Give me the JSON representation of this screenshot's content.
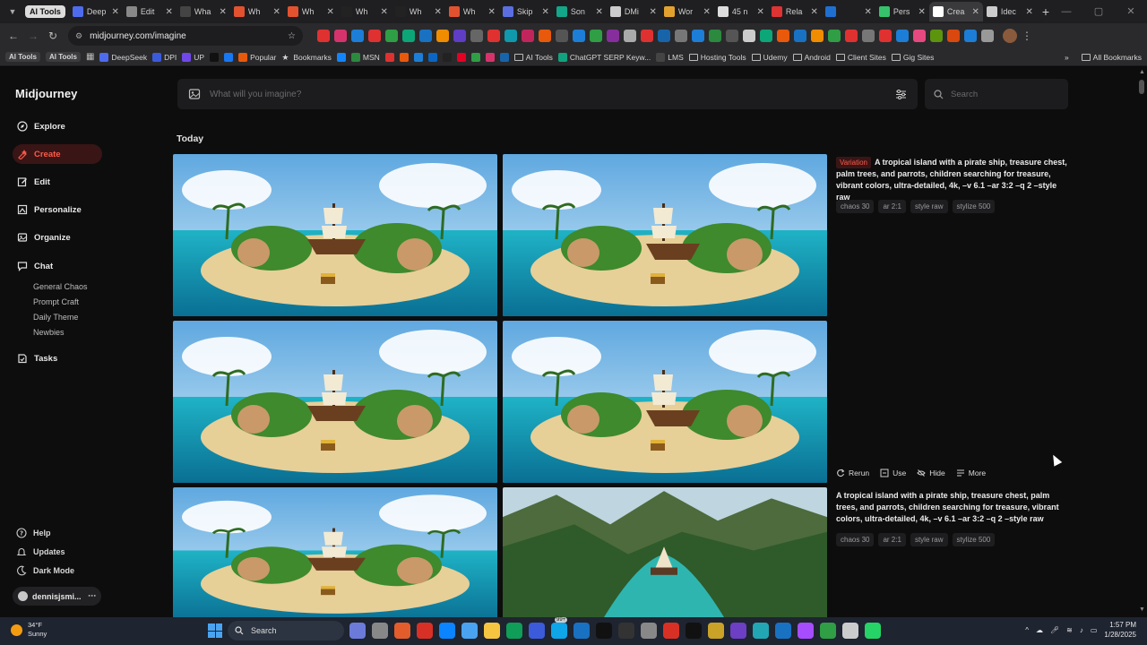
{
  "browser": {
    "tab_group_label": "AI Tools",
    "tabs": [
      {
        "title": "Deep",
        "color": "#4f6bed"
      },
      {
        "title": "Edit",
        "color": "#888888"
      },
      {
        "title": "Wha",
        "color": "#444444"
      },
      {
        "title": "Wh",
        "color": "#e2522f"
      },
      {
        "title": "Wh",
        "color": "#e2522f"
      },
      {
        "title": "Wh",
        "color": "#222222"
      },
      {
        "title": "Wh",
        "color": "#222222"
      },
      {
        "title": "Wh",
        "color": "#e2522f"
      },
      {
        "title": "Skip",
        "color": "#5b6ee1"
      },
      {
        "title": "Son",
        "color": "#13a689"
      },
      {
        "title": "DMi",
        "color": "#cccccc"
      },
      {
        "title": "Wor",
        "color": "#e2a12f"
      },
      {
        "title": "45 n",
        "color": "#dddddd"
      },
      {
        "title": "Rela",
        "color": "#d33"
      },
      {
        "title": "",
        "color": "#1f6fd1"
      },
      {
        "title": "Pers",
        "color": "#36c36c"
      },
      {
        "title": "Crea",
        "color": "#ffffff"
      },
      {
        "title": "Idec",
        "color": "#cccccc"
      }
    ],
    "active_tab_index": 16,
    "url": "midjourney.com/imagine",
    "bookmarks": {
      "chips": [
        "AI Tools",
        "AI Tools"
      ],
      "items": [
        {
          "label": "DeepSeek",
          "kind": "site",
          "color": "#4f6bed"
        },
        {
          "label": "DPI",
          "kind": "site",
          "color": "#3b5bdb"
        },
        {
          "label": "UP",
          "kind": "site",
          "color": "#7048e8"
        },
        {
          "label": "",
          "kind": "site",
          "color": "#111111"
        },
        {
          "label": "",
          "kind": "site",
          "color": "#1877f2"
        },
        {
          "label": "Popular",
          "kind": "site",
          "color": "#e8590c"
        },
        {
          "label": "Bookmarks",
          "kind": "star",
          "color": "#cccccc"
        },
        {
          "label": "",
          "kind": "site",
          "color": "#1185fe"
        },
        {
          "label": "MSN",
          "kind": "site",
          "color": "#2b8a3e"
        },
        {
          "label": "",
          "kind": "site",
          "color": "#e03131"
        },
        {
          "label": "",
          "kind": "site",
          "color": "#e8590c"
        },
        {
          "label": "",
          "kind": "site",
          "color": "#1c7ed6"
        },
        {
          "label": "",
          "kind": "site",
          "color": "#0a66c2"
        },
        {
          "label": "",
          "kind": "site",
          "color": "#222222"
        },
        {
          "label": "",
          "kind": "site",
          "color": "#e60023"
        },
        {
          "label": "",
          "kind": "site",
          "color": "#2f9e44"
        },
        {
          "label": "",
          "kind": "site",
          "color": "#d6336c"
        },
        {
          "label": "",
          "kind": "site",
          "color": "#1864ab"
        },
        {
          "label": "AI Tools",
          "kind": "folder",
          "color": "#cccccc"
        },
        {
          "label": "ChatGPT SERP Keyw...",
          "kind": "site",
          "color": "#10a37f"
        },
        {
          "label": "LMS",
          "kind": "site",
          "color": "#444444"
        },
        {
          "label": "Hosting Tools",
          "kind": "folder",
          "color": "#cccccc"
        },
        {
          "label": "Udemy",
          "kind": "folder",
          "color": "#cccccc"
        },
        {
          "label": "Android",
          "kind": "folder",
          "color": "#cccccc"
        },
        {
          "label": "Client Sites",
          "kind": "folder",
          "color": "#cccccc"
        },
        {
          "label": "Gig Sites",
          "kind": "folder",
          "color": "#cccccc"
        }
      ],
      "all_bookmarks": "All Bookmarks"
    },
    "extension_colors": [
      "#e03131",
      "#d6336c",
      "#1c7ed6",
      "#e03131",
      "#2f9e44",
      "#0ca678",
      "#1971c2",
      "#f08c00",
      "#5f3dc4",
      "#666666",
      "#e03131",
      "#1098ad",
      "#c2255c",
      "#e8590c",
      "#555555",
      "#1c7ed6",
      "#2f9e44",
      "#862e9c",
      "#aaaaaa",
      "#e03131",
      "#1864ab",
      "#777777",
      "#1c7ed6",
      "#2b8a3e",
      "#555555",
      "#cccccc",
      "#0ca678",
      "#e8590c",
      "#1971c2",
      "#f08c00",
      "#2f9e44",
      "#e03131",
      "#777777",
      "#e03131",
      "#1c7ed6",
      "#e64980",
      "#5c940d",
      "#d9480f",
      "#1c7ed6",
      "#999999"
    ]
  },
  "app": {
    "brand": "Midjourney",
    "nav": [
      {
        "label": "Explore",
        "icon": "compass-icon",
        "active": false
      },
      {
        "label": "Create",
        "icon": "create-icon",
        "active": true
      },
      {
        "label": "Edit",
        "icon": "edit-icon",
        "active": false
      },
      {
        "label": "Personalize",
        "icon": "personalize-icon",
        "active": false
      },
      {
        "label": "Organize",
        "icon": "image-icon",
        "active": false
      },
      {
        "label": "Chat",
        "icon": "chat-icon",
        "active": false
      }
    ],
    "chat_rooms": [
      "General Chaos",
      "Prompt Craft",
      "Daily Theme",
      "Newbies"
    ],
    "tasks": {
      "label": "Tasks",
      "icon": "tasks-icon"
    },
    "footer": [
      {
        "label": "Help",
        "icon": "help-icon"
      },
      {
        "label": "Updates",
        "icon": "bell-icon"
      },
      {
        "label": "Dark Mode",
        "icon": "moon-icon"
      }
    ],
    "user": "dennisjsmi...",
    "prompt_placeholder": "What will you imagine?",
    "search_placeholder": "Search",
    "section_title": "Today",
    "jobs": [
      {
        "tag": "Variation",
        "prompt": "A tropical island with a pirate ship, treasure chest, palm trees, and parrots, children searching for treasure, vibrant colors, ultra-detailed, 4k, –v 6.1 –ar 3:2 –q 2 –style raw",
        "params": [
          "chaos 30",
          "ar 2:1",
          "style raw",
          "stylize 500"
        ]
      },
      {
        "tag": "",
        "prompt": "A tropical island with a pirate ship, treasure chest, palm trees, and parrots, children searching for treasure, vibrant colors, ultra-detailed, 4k, –v 6.1 –ar 3:2 –q 2 –style raw",
        "params": [
          "chaos 30",
          "ar 2:1",
          "style raw",
          "stylize 500"
        ]
      }
    ],
    "actions": [
      {
        "label": "Rerun",
        "icon": "rerun-icon"
      },
      {
        "label": "Use",
        "icon": "use-icon"
      },
      {
        "label": "Hide",
        "icon": "eye-off-icon"
      },
      {
        "label": "More",
        "icon": "menu-icon"
      }
    ],
    "accent_color": "#ff5a4a"
  },
  "taskbar": {
    "weather_temp": "34°F",
    "weather_desc": "Sunny",
    "search_label": "Search",
    "badge": "99+",
    "time": "1:57 PM",
    "date": "1/28/2025",
    "app_colors": [
      "#6c7bd9",
      "#888888",
      "#e25c2c",
      "#d93025",
      "#0a84ff",
      "#4aa3f0",
      "#f5c542",
      "#0f9d58",
      "#3b5bdb",
      "#0ea5e9",
      "#1971c2",
      "#111111",
      "#333333",
      "#888888",
      "#d93025",
      "#111111",
      "#c9a227",
      "#6c3fc4",
      "#22a6b3",
      "#1971c2",
      "#a64dff",
      "#2f9e44",
      "#cccccc",
      "#25d366"
    ]
  }
}
